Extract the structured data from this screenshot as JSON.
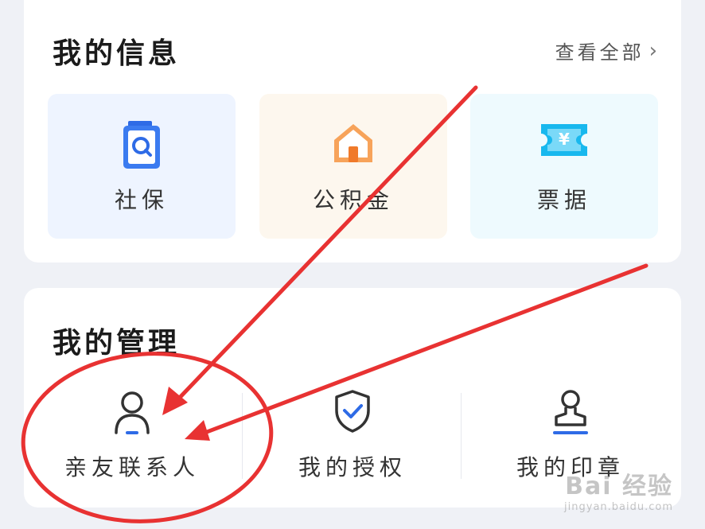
{
  "my_info": {
    "title": "我的信息",
    "view_all": "查看全部",
    "tiles": [
      {
        "label": "社保",
        "icon": "social-security-icon",
        "color": "#2e6be6"
      },
      {
        "label": "公积金",
        "icon": "house-icon",
        "color": "#f08a3c"
      },
      {
        "label": "票据",
        "icon": "ticket-yuan-icon",
        "color": "#17b6ee"
      }
    ]
  },
  "my_management": {
    "title": "我的管理",
    "items": [
      {
        "label": "亲友联系人",
        "icon": "person-icon"
      },
      {
        "label": "我的授权",
        "icon": "shield-check-icon"
      },
      {
        "label": "我的印章",
        "icon": "stamp-icon"
      }
    ]
  },
  "annotation": {
    "color": "#e83232",
    "shapes": [
      "red-circle",
      "red-arrow",
      "red-arrow"
    ]
  },
  "watermark": {
    "main": "Bai 经验",
    "sub": "jingyan.baidu.com"
  }
}
